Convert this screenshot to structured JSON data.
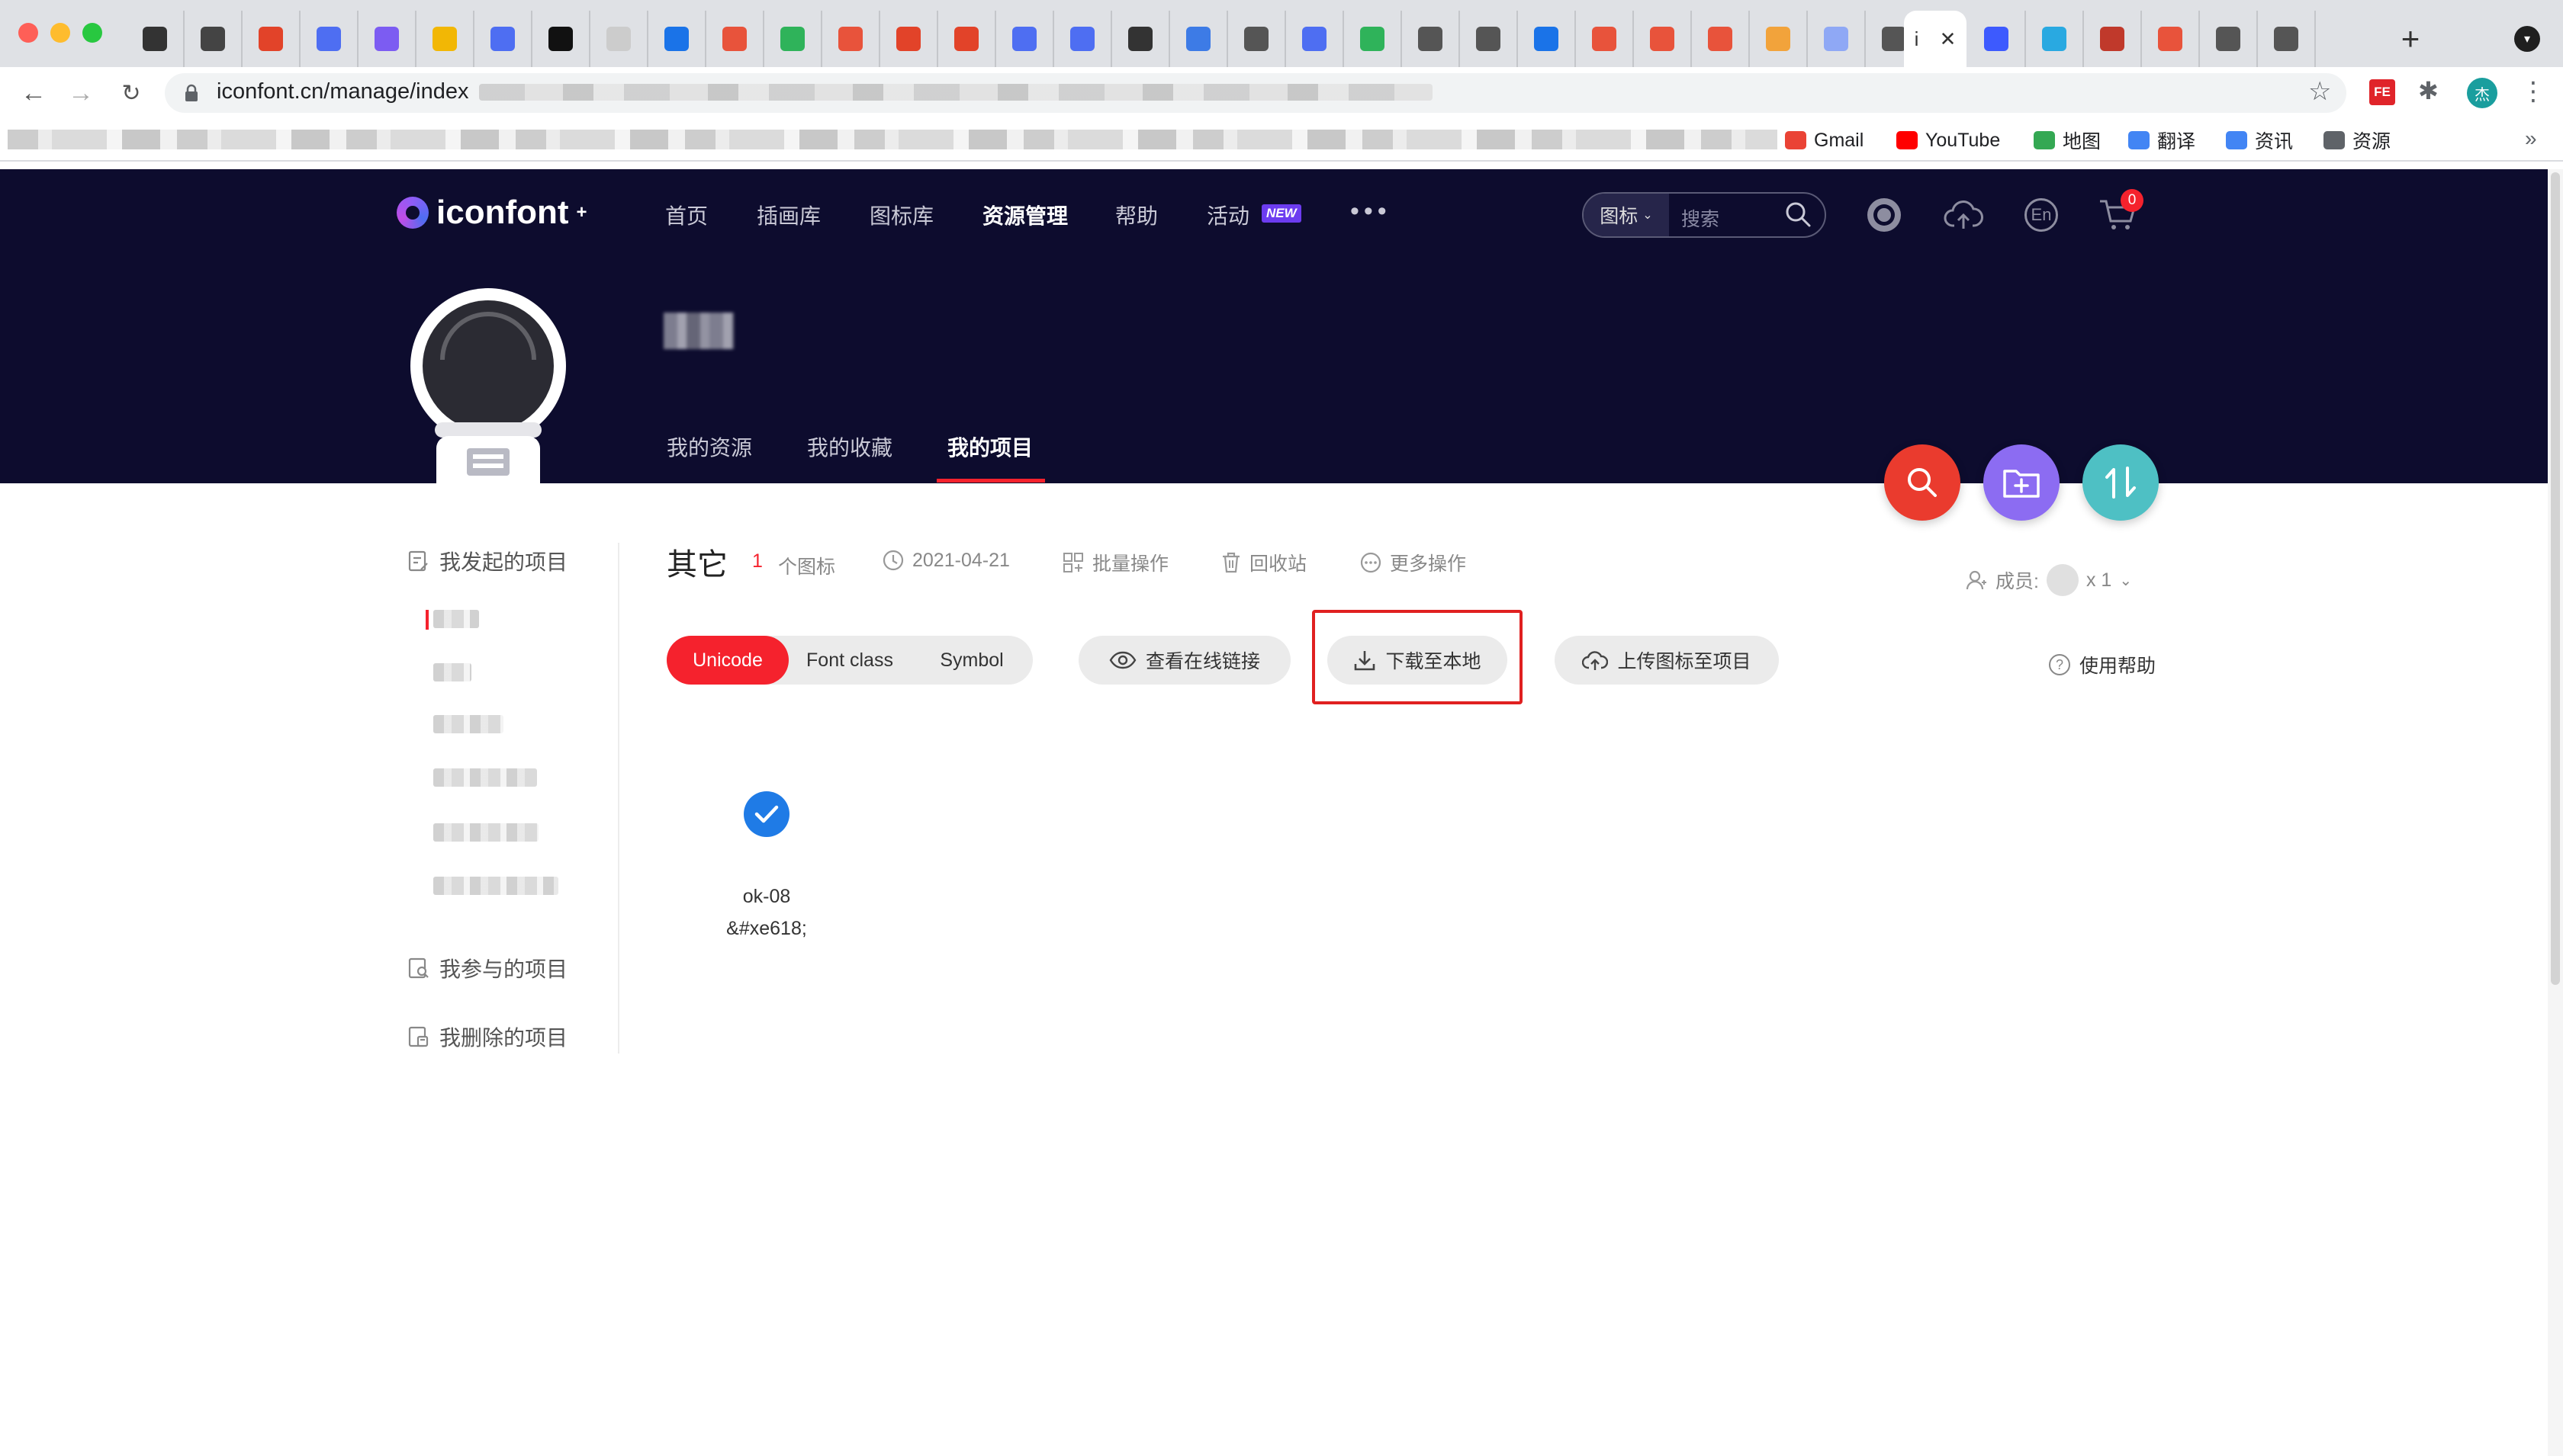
{
  "browser": {
    "active_tab_label": "i",
    "url": "iconfont.cn/manage/index",
    "new_tab": "+",
    "bookmarks": [
      {
        "label": "Gmail",
        "color": "#ea4335"
      },
      {
        "label": "YouTube",
        "color": "#ff0000"
      },
      {
        "label": "地图",
        "color": "#34a853"
      },
      {
        "label": "翻译",
        "color": "#4285f4"
      },
      {
        "label": "资讯",
        "color": "#4285f4"
      },
      {
        "label": "资源",
        "color": "#5f6368"
      }
    ],
    "bookmarks_more": "»",
    "profile_initial": "杰",
    "extension_label": "FE"
  },
  "header": {
    "logo": "iconfont",
    "logo_sup": "+",
    "nav": [
      "首页",
      "插画库",
      "图标库",
      "资源管理",
      "帮助",
      "活动"
    ],
    "nav_active": "资源管理",
    "nav_badge": "NEW",
    "nav_more": "•••",
    "search_type": "图标",
    "search_placeholder": "搜索",
    "lang": "En",
    "cart_count": "0"
  },
  "profile": {
    "tabs": [
      "我的资源",
      "我的收藏",
      "我的项目"
    ],
    "active_tab": "我的项目"
  },
  "sidebar": {
    "groups": [
      "我发起的项目",
      "我参与的项目",
      "我删除的项目"
    ]
  },
  "project": {
    "title": "其它",
    "icon_count": "1",
    "icon_count_label": "个图标",
    "date": "2021-04-21",
    "batch": "批量操作",
    "recycle": "回收站",
    "more": "更多操作",
    "members_label": "成员:",
    "members_count": "x 1",
    "modes": [
      "Unicode",
      "Font class",
      "Symbol"
    ],
    "active_mode": "Unicode",
    "view_online": "查看在线链接",
    "download": "下载至本地",
    "upload": "上传图标至项目",
    "help": "使用帮助"
  },
  "icons": [
    {
      "name": "ok-08",
      "code": "&#xe618;"
    }
  ],
  "colors": {
    "header_bg": "#0d0c2e",
    "accent_red": "#f5222d",
    "fab_search": "#ea3b2e",
    "fab_add": "#8c6cf2",
    "fab_sort": "#4ec0c4",
    "check_blue": "#1f7be6"
  },
  "icon_names": {
    "fab": [
      "search-icon",
      "folder-add-icon",
      "sort-icon"
    ],
    "header": [
      "user-icon",
      "cloud-upload-icon",
      "language-icon",
      "cart-icon"
    ]
  }
}
